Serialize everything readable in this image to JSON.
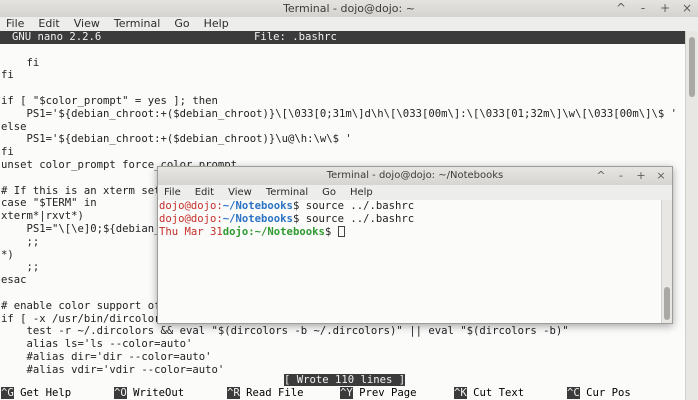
{
  "back": {
    "title": "Terminal - dojo@dojo: ~",
    "menus": [
      "File",
      "Edit",
      "View",
      "Terminal",
      "Go",
      "Help"
    ],
    "nano_name": "GNU nano 2.2.6",
    "nano_file": "File: .bashrc",
    "lines": [
      "",
      "    fi",
      "fi",
      "",
      "if [ \"$color_prompt\" = yes ]; then",
      "    PS1='${debian_chroot:+($debian_chroot)}\\[\\033[0;31m\\]d\\h\\[\\033[00m\\]:\\[\\033[01;32m\\]\\w\\[\\033[00m\\]\\$ '",
      "else",
      "    PS1='${debian_chroot:+($debian_chroot)}\\u@\\h:\\w\\$ '",
      "fi",
      "unset color_prompt force_color_prompt",
      "",
      "# If this is an xterm set",
      "case \"$TERM\" in",
      "xterm*|rxvt*)",
      "    PS1=\"\\[\\e]0;${debian_",
      "    ;;",
      "*)",
      "    ;;",
      "esac",
      "",
      "# enable color support of",
      "if [ -x /usr/bin/dircolor",
      "    test -r ~/.dircolors && eval \"$(dircolors -b ~/.dircolors)\" || eval \"$(dircolors -b)\"",
      "    alias ls='ls --color=auto'",
      "    #alias dir='dir --color=auto'",
      "    #alias vdir='vdir --color=auto'"
    ],
    "status": "[ Wrote 110 lines ]",
    "shortcuts": [
      {
        "key": "^G",
        "label": "Get Help"
      },
      {
        "key": "^O",
        "label": "WriteOut"
      },
      {
        "key": "^R",
        "label": "Read File"
      },
      {
        "key": "^Y",
        "label": "Prev Page"
      },
      {
        "key": "^K",
        "label": "Cut Text"
      },
      {
        "key": "^C",
        "label": "Cur Pos"
      }
    ]
  },
  "front": {
    "title": "Terminal - dojo@dojo: ~/Notebooks",
    "menus": [
      "File",
      "Edit",
      "View",
      "Terminal",
      "Go",
      "Help"
    ],
    "rows": [
      {
        "user": "dojo@dojo:",
        "path": "~/Notebooks",
        "rest": "$ source ../.bashrc"
      },
      {
        "user": "dojo@dojo:",
        "path": "~/Notebooks",
        "rest": "$ source ../.bashrc"
      }
    ],
    "last_prompt": {
      "date": "Thu Mar 31",
      "user": "dojo:",
      "path": "~/Notebooks",
      "rest": "$ "
    }
  },
  "controls": [
    "^",
    "-",
    "+",
    "×"
  ]
}
